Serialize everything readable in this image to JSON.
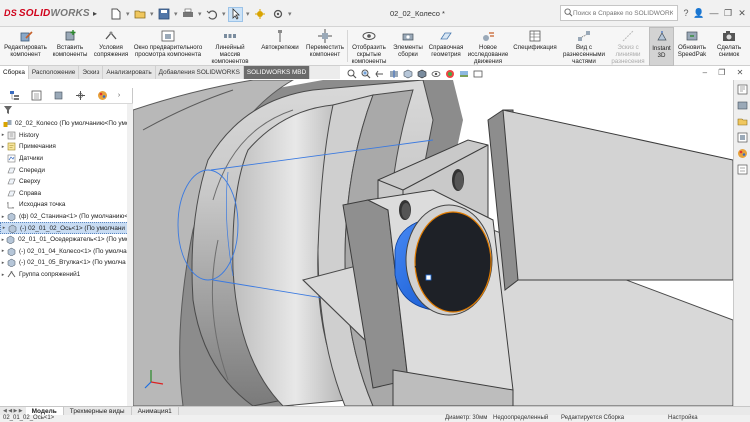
{
  "app": {
    "logo_brand": "SOLIDWORKS",
    "logo_ds": "DS",
    "logo_solid": "SOLID",
    "logo_works": "WORKS",
    "document_title": "02_02_Колесо *",
    "search_placeholder": "Поиск в Справке по SOLIDWORKS",
    "title_icons": [
      "search-icon",
      "help-icon",
      "user-icon",
      "minimize-icon",
      "restore-icon",
      "close-icon"
    ],
    "title_glyphs": [
      "?",
      "👤",
      "—",
      "❐",
      "✕"
    ]
  },
  "quick_access": [
    "new-document-icon",
    "open-icon",
    "save-icon",
    "print-icon",
    "undo-icon",
    "select-icon",
    "rebuild-icon",
    "options-icon"
  ],
  "commands": [
    {
      "label": "Редактировать\nкомпонент",
      "icon": "edit-component-icon",
      "enabled": true,
      "active": false
    },
    {
      "label": "Вставить\nкомпоненты",
      "icon": "insert-components-icon",
      "enabled": true,
      "active": false
    },
    {
      "label": "Условия\nсопряжения",
      "icon": "mate-icon",
      "enabled": true,
      "active": false
    },
    {
      "label": "Окно предварительного\nпросмотра компонента",
      "icon": "component-preview-icon",
      "enabled": true,
      "active": false
    },
    {
      "label": "Линейный массив\nкомпонентов",
      "icon": "linear-pattern-icon",
      "enabled": true,
      "active": false
    },
    {
      "label": "Автокрепежи",
      "icon": "smart-fasteners-icon",
      "enabled": true,
      "active": false
    },
    {
      "label": "Переместить\nкомпонент",
      "icon": "move-component-icon",
      "enabled": true,
      "active": false
    },
    {
      "label": "Отобразить\nскрытые\nкомпоненты",
      "icon": "show-hidden-icon",
      "enabled": true,
      "active": false
    },
    {
      "label": "Элементы\nсборки",
      "icon": "assembly-features-icon",
      "enabled": true,
      "active": false
    },
    {
      "label": "Справочная\nгеометрия",
      "icon": "reference-geometry-icon",
      "enabled": true,
      "active": false
    },
    {
      "label": "Новое\nисследование\nдвижения",
      "icon": "motion-study-icon",
      "enabled": true,
      "active": false
    },
    {
      "label": "Спецификация",
      "icon": "bom-icon",
      "enabled": true,
      "active": false
    },
    {
      "label": "Вид с\nразнесенными\nчастями",
      "icon": "exploded-view-icon",
      "enabled": true,
      "active": false
    },
    {
      "label": "Эскиз с\nлиниями\nразнесения",
      "icon": "explode-line-sketch-icon",
      "enabled": false,
      "active": false
    },
    {
      "label": "Instant\n3D",
      "icon": "instant3d-icon",
      "enabled": true,
      "active": true
    },
    {
      "label": "Обновить\nSpeedPak",
      "icon": "speedpak-icon",
      "enabled": true,
      "active": false
    },
    {
      "label": "Сделать\nснимок",
      "icon": "snapshot-icon",
      "enabled": true,
      "active": false
    }
  ],
  "tabs": [
    {
      "label": "Сборка",
      "active": true
    },
    {
      "label": "Расположение",
      "active": false
    },
    {
      "label": "Эскиз",
      "active": false
    },
    {
      "label": "Анализировать",
      "active": false
    },
    {
      "label": "Добавления SOLIDWORKS",
      "active": false
    },
    {
      "label": "SOLIDWORKS MBD",
      "active": false
    }
  ],
  "feature_manager": {
    "panel_tabs": [
      "feature-tree-icon",
      "property-manager-icon",
      "configuration-manager-icon",
      "dimxpert-icon",
      "display-manager-icon"
    ],
    "tree": [
      {
        "label": "02_02_Колесо  (По умолчанию<По умол",
        "icon": "assembly-icon",
        "expand": "",
        "selected": false
      },
      {
        "label": "History",
        "icon": "history-icon",
        "expand": "▸",
        "selected": false
      },
      {
        "label": "Примечания",
        "icon": "annotations-icon",
        "expand": "▸",
        "selected": false
      },
      {
        "label": "Датчики",
        "icon": "sensors-icon",
        "expand": "",
        "selected": false
      },
      {
        "label": "Спереди",
        "icon": "plane-icon",
        "expand": "",
        "selected": false
      },
      {
        "label": "Сверху",
        "icon": "plane-icon",
        "expand": "",
        "selected": false
      },
      {
        "label": "Справа",
        "icon": "plane-icon",
        "expand": "",
        "selected": false
      },
      {
        "label": "Исходная точка",
        "icon": "origin-icon",
        "expand": "",
        "selected": false
      },
      {
        "label": "(ф) 02_Станина<1> (По умолчанию<",
        "icon": "part-icon",
        "expand": "▸",
        "selected": false
      },
      {
        "label": "(-) 02_01_02_Ось<1> (По умолчани",
        "icon": "part-icon",
        "expand": "▸",
        "selected": true
      },
      {
        "label": "02_01_01_Оседержатель<1> (По умол",
        "icon": "part-icon",
        "expand": "▸",
        "selected": false
      },
      {
        "label": "(-) 02_01_04_Колесо<1> (По умолчан",
        "icon": "part-icon",
        "expand": "▸",
        "selected": false
      },
      {
        "label": "(-) 02_01_05_Втулка<1> (По умолча",
        "icon": "part-icon",
        "expand": "▸",
        "selected": false
      },
      {
        "label": "Группа сопряжений1",
        "icon": "mates-group-icon",
        "expand": "▸",
        "selected": false
      }
    ]
  },
  "heads_up_toolbar": [
    "zoom-to-fit-icon",
    "zoom-area-icon",
    "previous-view-icon",
    "section-view-icon",
    "view-orientation-icon",
    "display-style-icon",
    "hide-show-icon",
    "edit-appearance-icon",
    "apply-scene-icon",
    "view-settings-icon"
  ],
  "task_pane": [
    "resources-icon",
    "design-library-icon",
    "file-explorer-icon",
    "view-palette-icon",
    "appearances-icon",
    "custom-properties-icon"
  ],
  "bottom_tabs": [
    {
      "label": "Модель",
      "active": true
    },
    {
      "label": "Трехмерные виды",
      "active": false
    },
    {
      "label": "Анимация1",
      "active": false
    }
  ],
  "status": {
    "left": "02_01_02_Ось<1>",
    "diameter": "Диаметр: 30мм",
    "state": "Недоопределенный",
    "mode": "Редактируется Сборка",
    "settings": "Настройка"
  },
  "colors": {
    "selection_blue": "#1f6fe0",
    "highlight_orange": "#e07b00",
    "sw_red": "#d0021b"
  }
}
